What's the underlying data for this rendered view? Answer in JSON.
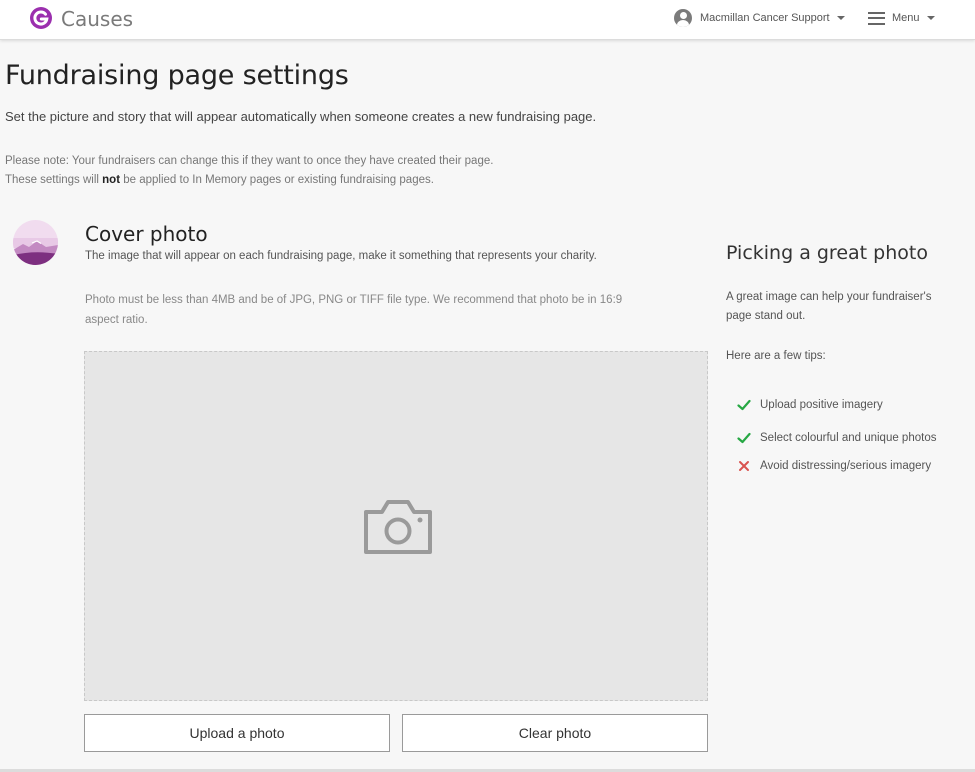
{
  "header": {
    "brand": "Causes",
    "account_name": "Macmillan Cancer Support",
    "menu_label": "Menu",
    "brand_color": "#9b2fae"
  },
  "page": {
    "title": "Fundraising page settings",
    "intro": "Set the picture and story that will appear automatically when someone creates a new fundraising page.",
    "note_line1": "Please note: Your fundraisers can change this if they want to once they have created their page.",
    "note_line2_pre": "These settings will ",
    "note_line2_bold": "not",
    "note_line2_post": " be applied to In Memory pages or existing fundraising pages."
  },
  "cover_photo": {
    "title": "Cover photo",
    "description": "The image that will appear on each fundraising page, make it something that represents your charity.",
    "requirements": "Photo must be less than 4MB and be of JPG, PNG or TIFF file type. We recommend that photo be in 16:9 aspect ratio.",
    "upload_label": "Upload a photo",
    "clear_label": "Clear photo"
  },
  "sidebar": {
    "title": "Picking a great photo",
    "text": "A great image can help your fundraiser's page stand out.",
    "tips_heading": "Here are a few tips:",
    "tips": [
      {
        "label": "Upload positive imagery",
        "type": "do"
      },
      {
        "label": "Select colourful and unique photos",
        "type": "do"
      },
      {
        "label": "Avoid distressing/serious imagery",
        "type": "dont"
      }
    ],
    "do_color": "#27a844",
    "dont_color": "#d9534f"
  }
}
